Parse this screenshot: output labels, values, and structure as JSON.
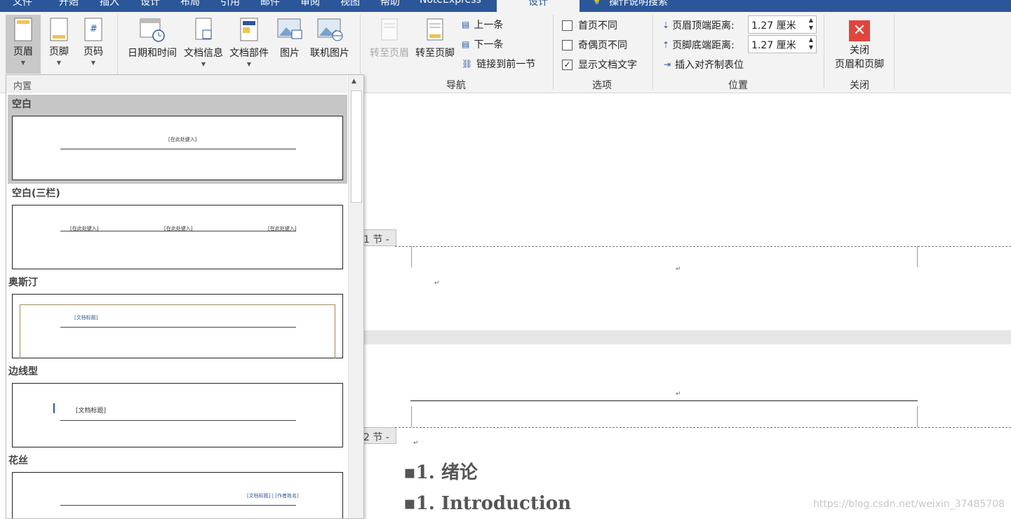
{
  "tabs": [
    "文件",
    "开始",
    "插入",
    "设计",
    "布局",
    "引用",
    "邮件",
    "审阅",
    "视图",
    "帮助",
    "NoteExpress",
    "设计",
    "操作说明搜索"
  ],
  "ribbon": {
    "header_footer": {
      "header": "页眉",
      "footer": "页脚",
      "page_number": "页码"
    },
    "insert": {
      "datetime": "日期和时间",
      "doc_info": "文档信息",
      "doc_parts": "文档部件",
      "picture": "图片",
      "online_picture": "联机图片"
    },
    "nav": {
      "goto_header": "转至页眉",
      "goto_footer": "转至页脚",
      "prev": "上一条",
      "next": "下一条",
      "link_prev": "链接到前一节",
      "group": "导航"
    },
    "options": {
      "first_diff": "首页不同",
      "odd_even_diff": "奇偶页不同",
      "show_doc_text": "显示文档文字",
      "group": "选项",
      "first_diff_checked": false,
      "odd_even_checked": false,
      "show_doc_text_checked": true
    },
    "position": {
      "header_top_label": "页眉顶端距离:",
      "header_top_value": "1.27 厘米",
      "footer_bottom_label": "页脚底端距离:",
      "footer_bottom_value": "1.27 厘米",
      "insert_tab": "插入对齐制表位",
      "group": "位置"
    },
    "close": {
      "line1": "关闭",
      "line2": "页眉和页脚",
      "group": "关闭"
    }
  },
  "gallery": {
    "section": "内置",
    "items": [
      {
        "name": "空白",
        "placeholders": [
          "[在此处键入]"
        ]
      },
      {
        "name": "空白(三栏)",
        "placeholders": [
          "[在此处键入]",
          "[在此处键入]",
          "[在此处键入]"
        ]
      },
      {
        "name": "奥斯汀",
        "placeholders": [
          "[文档标题]"
        ]
      },
      {
        "name": "边线型",
        "placeholders": [
          "[文档标题]"
        ]
      },
      {
        "name": "花丝",
        "placeholders": [
          "[文档标题] | [作者姓名]"
        ]
      }
    ]
  },
  "document": {
    "section1": "1 节 -",
    "section2": "2 节 -",
    "return_mark": "↵",
    "heading1": "1.  绪论",
    "heading2": "1. Introduction",
    "watermark": "https://blog.csdn.net/weixin_37485708"
  },
  "colors": {
    "tabbar": "#2b579a",
    "ribbon": "#f3f3f3",
    "close_red": "#e0443c",
    "selected_item": "#c6c6c6"
  }
}
